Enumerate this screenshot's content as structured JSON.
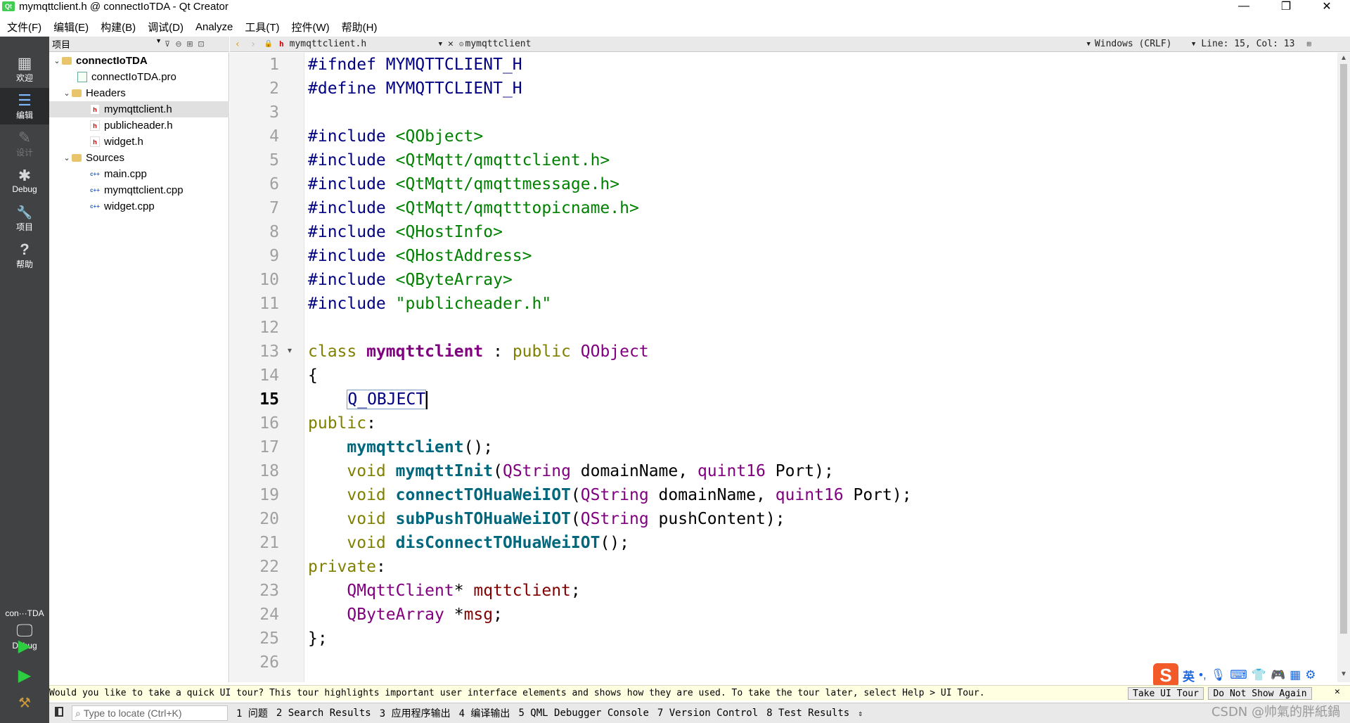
{
  "window": {
    "logo": "Qt",
    "title": "mymqttclient.h @ connectIoTDA - Qt Creator",
    "minimize": "—",
    "restore": "❐",
    "close": "✕"
  },
  "menu": [
    "文件(F)",
    "编辑(E)",
    "构建(B)",
    "调试(D)",
    "Analyze",
    "工具(T)",
    "控件(W)",
    "帮助(H)"
  ],
  "modes": [
    {
      "label": "欢迎",
      "icon": "grid-icon",
      "glyph": "▦"
    },
    {
      "label": "编辑",
      "icon": "edit-icon",
      "glyph": "☰"
    },
    {
      "label": "设计",
      "icon": "pencil-icon",
      "glyph": "✎"
    },
    {
      "label": "Debug",
      "icon": "bug-icon",
      "glyph": "✱"
    },
    {
      "label": "项目",
      "icon": "wrench-icon",
      "glyph": "🔧"
    },
    {
      "label": "帮助",
      "icon": "help-icon",
      "glyph": "?"
    }
  ],
  "kit": {
    "project": "con···TDA",
    "config": "Debug"
  },
  "project_panel": {
    "selector": "项目",
    "tree": [
      {
        "label": "connectIoTDA",
        "type": "folder",
        "level": 0,
        "expanded": true
      },
      {
        "label": "connectIoTDA.pro",
        "type": "pro",
        "level": 1
      },
      {
        "label": "Headers",
        "type": "folder",
        "level": 1,
        "expanded": true
      },
      {
        "label": "mymqttclient.h",
        "type": "hdr",
        "level": 2,
        "selected": true
      },
      {
        "label": "publicheader.h",
        "type": "hdr",
        "level": 2
      },
      {
        "label": "widget.h",
        "type": "hdr",
        "level": 2
      },
      {
        "label": "Sources",
        "type": "folder",
        "level": 1,
        "expanded": true
      },
      {
        "label": "main.cpp",
        "type": "cpp",
        "level": 2
      },
      {
        "label": "mymqttclient.cpp",
        "type": "cpp",
        "level": 2
      },
      {
        "label": "widget.cpp",
        "type": "cpp",
        "level": 2
      }
    ]
  },
  "editor_toolbar": {
    "file": "mymqttclient.h",
    "symbol": "mymqttclient",
    "line_ending": "Windows (CRLF)",
    "position": "Line: 15, Col: 13"
  },
  "editor": {
    "current_line": 15,
    "lines": [
      [
        [
          "pp",
          "#ifndef MYMQTTCLIENT_H"
        ]
      ],
      [
        [
          "pp",
          "#define MYMQTTCLIENT_H"
        ]
      ],
      [],
      [
        [
          "pp",
          "#include "
        ],
        [
          "inc",
          "<QObject>"
        ]
      ],
      [
        [
          "pp",
          "#include "
        ],
        [
          "inc",
          "<QtMqtt/qmqttclient.h>"
        ]
      ],
      [
        [
          "pp",
          "#include "
        ],
        [
          "inc",
          "<QtMqtt/qmqttmessage.h>"
        ]
      ],
      [
        [
          "pp",
          "#include "
        ],
        [
          "inc",
          "<QtMqtt/qmqtttopicname.h>"
        ]
      ],
      [
        [
          "pp",
          "#include "
        ],
        [
          "inc",
          "<QHostInfo>"
        ]
      ],
      [
        [
          "pp",
          "#include "
        ],
        [
          "inc",
          "<QHostAddress>"
        ]
      ],
      [
        [
          "pp",
          "#include "
        ],
        [
          "inc",
          "<QByteArray>"
        ]
      ],
      [
        [
          "pp",
          "#include "
        ],
        [
          "inc",
          "\"publicheader.h\""
        ]
      ],
      [],
      [
        [
          "kw",
          "class "
        ],
        [
          "cls",
          "mymqttclient"
        ],
        [
          "txt",
          " : "
        ],
        [
          "kw",
          "public "
        ],
        [
          "tp",
          "QObject"
        ]
      ],
      [
        [
          "txt",
          "{"
        ]
      ],
      [
        [
          "txt",
          "    "
        ],
        [
          "macro",
          "Q_OBJECT"
        ],
        [
          "cursor",
          ""
        ]
      ],
      [
        [
          "kw",
          "public"
        ],
        [
          "txt",
          ":"
        ]
      ],
      [
        [
          "txt",
          "    "
        ],
        [
          "fn",
          "mymqttclient"
        ],
        [
          "txt",
          "();"
        ]
      ],
      [
        [
          "txt",
          "    "
        ],
        [
          "kw",
          "void "
        ],
        [
          "fn",
          "mymqttInit"
        ],
        [
          "txt",
          "("
        ],
        [
          "tp",
          "QString"
        ],
        [
          "txt",
          " domainName, "
        ],
        [
          "tp",
          "quint16"
        ],
        [
          "txt",
          " Port);"
        ]
      ],
      [
        [
          "txt",
          "    "
        ],
        [
          "kw",
          "void "
        ],
        [
          "fn",
          "connectTOHuaWeiIOT"
        ],
        [
          "txt",
          "("
        ],
        [
          "tp",
          "QString"
        ],
        [
          "txt",
          " domainName, "
        ],
        [
          "tp",
          "quint16"
        ],
        [
          "txt",
          " Port);"
        ]
      ],
      [
        [
          "txt",
          "    "
        ],
        [
          "kw",
          "void "
        ],
        [
          "fn",
          "subPushTOHuaWeiIOT"
        ],
        [
          "txt",
          "("
        ],
        [
          "tp",
          "QString"
        ],
        [
          "txt",
          " pushContent);"
        ]
      ],
      [
        [
          "txt",
          "    "
        ],
        [
          "kw",
          "void "
        ],
        [
          "fn",
          "disConnectTOHuaWeiIOT"
        ],
        [
          "txt",
          "();"
        ]
      ],
      [
        [
          "kw",
          "private"
        ],
        [
          "txt",
          ":"
        ]
      ],
      [
        [
          "txt",
          "    "
        ],
        [
          "tp",
          "QMqttClient"
        ],
        [
          "txt",
          "* "
        ],
        [
          "mem",
          "mqttclient"
        ],
        [
          "txt",
          ";"
        ]
      ],
      [
        [
          "txt",
          "    "
        ],
        [
          "tp",
          "QByteArray"
        ],
        [
          "txt",
          " *"
        ],
        [
          "mem",
          "msg"
        ],
        [
          "txt",
          ";"
        ]
      ],
      [
        [
          "txt",
          "};"
        ]
      ],
      []
    ]
  },
  "tour": {
    "message": "Would you like to take a quick UI tour? This tour highlights important user interface elements and shows how they are used. To take the tour later, select Help > UI Tour.",
    "take_tour": "Take UI Tour",
    "dont_show": "Do Not Show Again"
  },
  "locator": {
    "placeholder": "Type to locate (Ctrl+K)"
  },
  "output_panes": [
    "1 问题",
    "2 Search Results",
    "3 应用程序输出",
    "4 编译输出",
    "5 QML Debugger Console",
    "7 Version Control",
    "8 Test Results"
  ],
  "ime": {
    "logo": "S",
    "lang": "英"
  },
  "watermark": "CSDN @帅氣的胖紙鍋",
  "colors": {
    "modebar": "#404244",
    "accent_run": "#2ecc40",
    "preprocessor": "#000080",
    "include": "#008000",
    "keyword": "#808000",
    "type": "#800080",
    "function": "#00677c"
  }
}
